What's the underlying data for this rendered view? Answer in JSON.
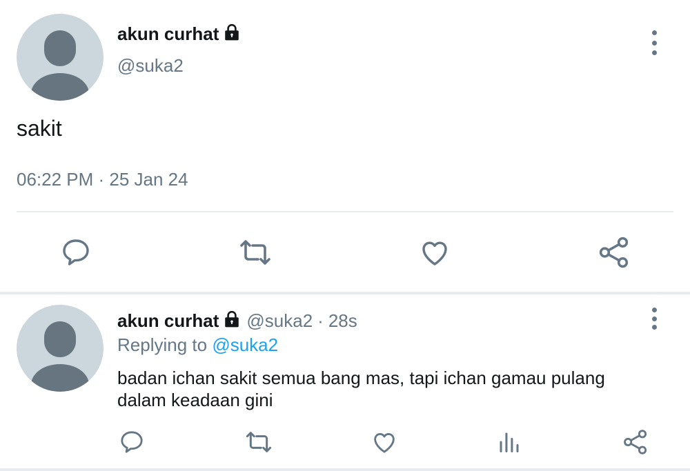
{
  "main_tweet": {
    "author_name": "akun curhat",
    "handle": "@suka2",
    "text": "sakit",
    "timestamp": "06:22 PM · 25 Jan 24",
    "icons": [
      "lock-icon",
      "more-icon",
      "reply-icon",
      "retweet-icon",
      "like-icon",
      "share-icon"
    ]
  },
  "reply_tweet": {
    "author_name": "akun curhat",
    "handle": "@suka2",
    "separator": "·",
    "time": "28s",
    "replying_prefix": "Replying to",
    "replying_to": "@suka2",
    "text_line1": "badan ichan sakit semua bang mas, tapi ichan gamau pulang",
    "text_line2": "dalam keadaan gini",
    "icons": [
      "lock-icon",
      "more-icon",
      "reply-icon",
      "retweet-icon",
      "like-icon",
      "analytics-icon",
      "share-icon"
    ]
  },
  "colors": {
    "text": "#14171a",
    "muted": "#657786",
    "link": "#1da1f2",
    "avatar_bg": "#ccd6dd",
    "divider": "#e6ecf0"
  }
}
